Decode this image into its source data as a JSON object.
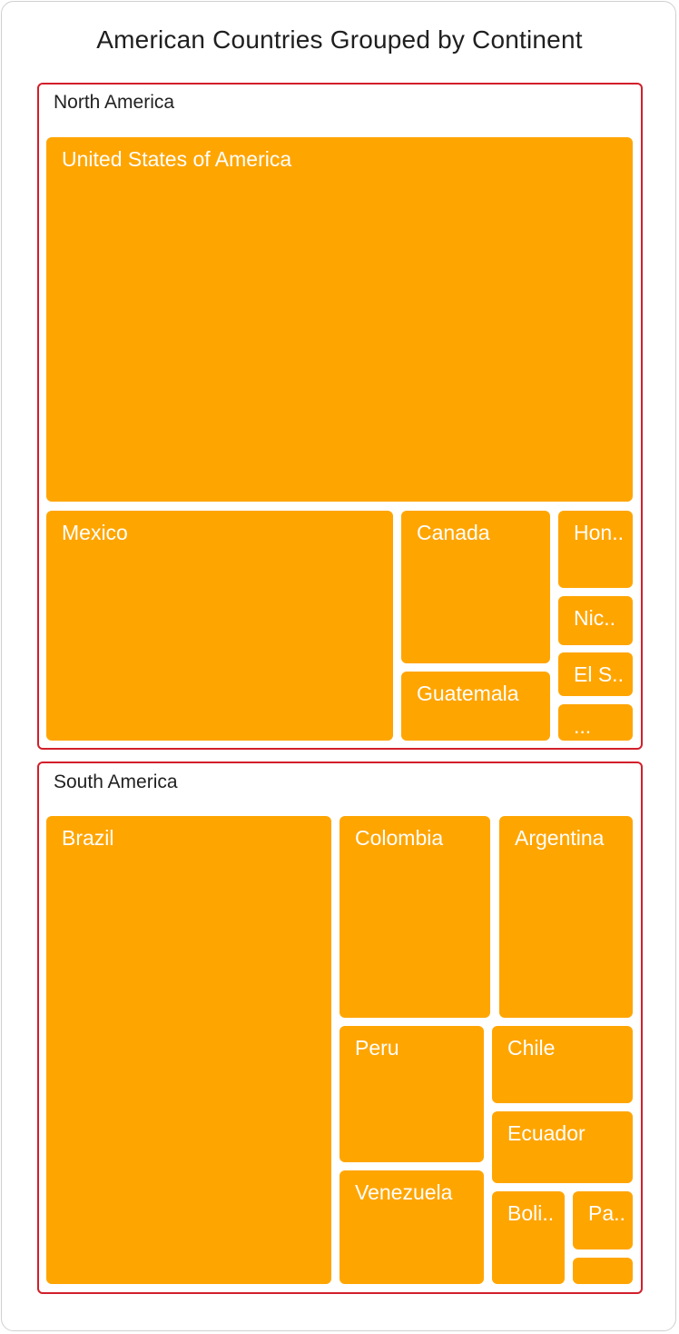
{
  "chart_data": {
    "type": "treemap",
    "title": "American Countries Grouped by Continent",
    "tile_color": "#FFA500",
    "group_border_color": "#D21F2B",
    "groups": [
      {
        "name": "North America",
        "items": [
          {
            "label": "United States of America"
          },
          {
            "label": "Mexico"
          },
          {
            "label": "Canada"
          },
          {
            "label": "Guatemala"
          },
          {
            "label": "Hon.."
          },
          {
            "label": "Nic.."
          },
          {
            "label": "El S.."
          },
          {
            "label": "..."
          }
        ]
      },
      {
        "name": "South America",
        "items": [
          {
            "label": "Brazil"
          },
          {
            "label": "Colombia"
          },
          {
            "label": "Argentina"
          },
          {
            "label": "Peru"
          },
          {
            "label": "Chile"
          },
          {
            "label": "Ecuador"
          },
          {
            "label": "Venezuela"
          },
          {
            "label": "Boli.."
          },
          {
            "label": "Pa.."
          },
          {
            "label": "..."
          }
        ]
      }
    ]
  }
}
